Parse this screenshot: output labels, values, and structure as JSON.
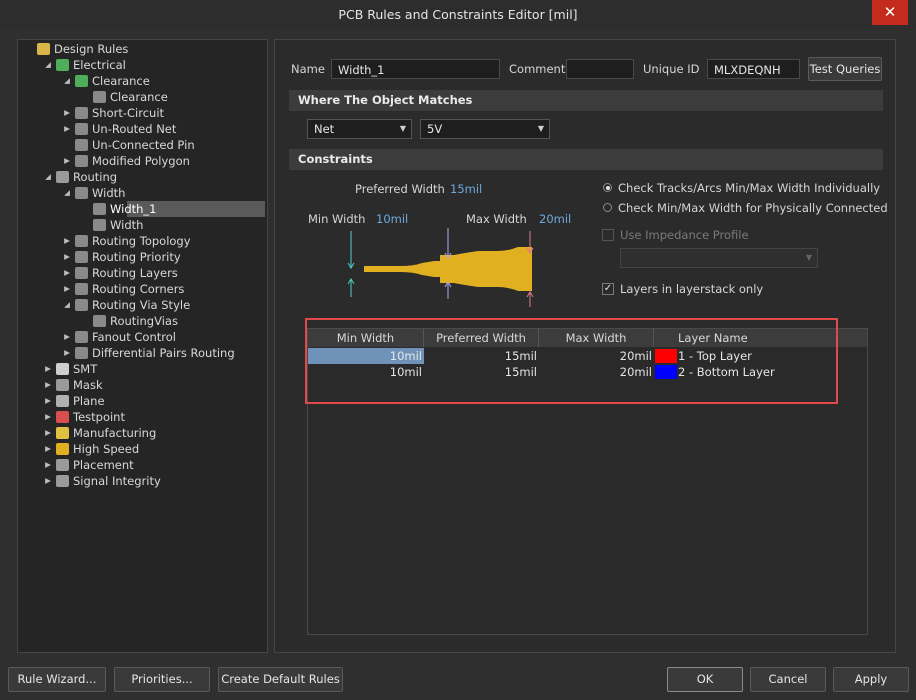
{
  "window": {
    "title": "PCB Rules and Constraints Editor [mil]",
    "close": "✕"
  },
  "colors": {
    "top_layer": "#ff0000",
    "bottom_layer": "#0000ff",
    "highlight": "#e04a4a",
    "trace": "#e0b020"
  },
  "tree": [
    {
      "label": "Design Rules",
      "icon": "design-rules-icon",
      "expanded": true
    },
    {
      "label": "Electrical",
      "icon": "electrical-rule-icon",
      "expanded": true
    },
    {
      "label": "Clearance",
      "icon": "clearance-rule-icon",
      "expanded": true
    },
    {
      "label": "Clearance",
      "icon": "rule-icon"
    },
    {
      "label": "Short-Circuit",
      "icon": "rule-icon",
      "expanded": false
    },
    {
      "label": "Un-Routed Net",
      "icon": "rule-icon",
      "expanded": false
    },
    {
      "label": "Un-Connected Pin",
      "icon": "rule-icon"
    },
    {
      "label": "Modified Polygon",
      "icon": "rule-icon",
      "expanded": false
    },
    {
      "label": "Routing",
      "icon": "routing-icon",
      "expanded": true
    },
    {
      "label": "Width",
      "icon": "width-rule-icon",
      "expanded": true
    },
    {
      "label": "Width_1",
      "icon": "width-rule-icon",
      "selected": true
    },
    {
      "label": "Width",
      "icon": "width-rule-icon"
    },
    {
      "label": "Routing Topology",
      "icon": "rule-icon",
      "expanded": false
    },
    {
      "label": "Routing Priority",
      "icon": "rule-icon",
      "expanded": false
    },
    {
      "label": "Routing Layers",
      "icon": "rule-icon",
      "expanded": false
    },
    {
      "label": "Routing Corners",
      "icon": "rule-icon",
      "expanded": false
    },
    {
      "label": "Routing Via Style",
      "icon": "rule-icon",
      "expanded": true
    },
    {
      "label": "RoutingVias",
      "icon": "rule-icon"
    },
    {
      "label": "Fanout Control",
      "icon": "rule-icon",
      "expanded": false
    },
    {
      "label": "Differential Pairs Routing",
      "icon": "rule-icon",
      "expanded": false
    },
    {
      "label": "SMT",
      "icon": "smt-icon",
      "expanded": false
    },
    {
      "label": "Mask",
      "icon": "mask-icon",
      "expanded": false
    },
    {
      "label": "Plane",
      "icon": "plane-icon",
      "expanded": false
    },
    {
      "label": "Testpoint",
      "icon": "testpoint-icon",
      "expanded": false
    },
    {
      "label": "Manufacturing",
      "icon": "manufacturing-icon",
      "expanded": false
    },
    {
      "label": "High Speed",
      "icon": "high-speed-icon",
      "expanded": false
    },
    {
      "label": "Placement",
      "icon": "placement-icon",
      "expanded": false
    },
    {
      "label": "Signal Integrity",
      "icon": "signal-integrity-icon",
      "expanded": false
    }
  ],
  "header": {
    "name_label": "Name",
    "name_value": "Width_1",
    "comment_label": "Comment",
    "comment_value": "",
    "uid_label": "Unique ID",
    "uid_value": "MLXDEQNH",
    "test_queries": "Test Queries"
  },
  "matches": {
    "title": "Where The Object Matches",
    "type": "Net",
    "value": "5V"
  },
  "constraints": {
    "title": "Constraints",
    "preferred_label": "Preferred Width",
    "preferred_value": "15mil",
    "min_label": "Min Width",
    "min_value": "10mil",
    "max_label": "Max Width",
    "max_value": "20mil",
    "radio1": "Check Tracks/Arcs Min/Max Width Individually",
    "radio2": "Check Min/Max Width for Physically Connected",
    "impedance": "Use Impedance Profile",
    "layerstack": "Layers in layerstack only"
  },
  "table": {
    "headers": [
      "Min Width",
      "Preferred Width",
      "Max Width",
      "Layer Name"
    ],
    "rows": [
      {
        "min": "10mil",
        "pref": "15mil",
        "max": "20mil",
        "layer": "1 - Top Layer",
        "color": "#ff0000"
      },
      {
        "min": "10mil",
        "pref": "15mil",
        "max": "20mil",
        "layer": "2 - Bottom Layer",
        "color": "#0000ff"
      }
    ]
  },
  "footer": {
    "rule_wizard": "Rule Wizard...",
    "priorities": "Priorities...",
    "create_default": "Create Default Rules",
    "ok": "OK",
    "cancel": "Cancel",
    "apply": "Apply"
  }
}
